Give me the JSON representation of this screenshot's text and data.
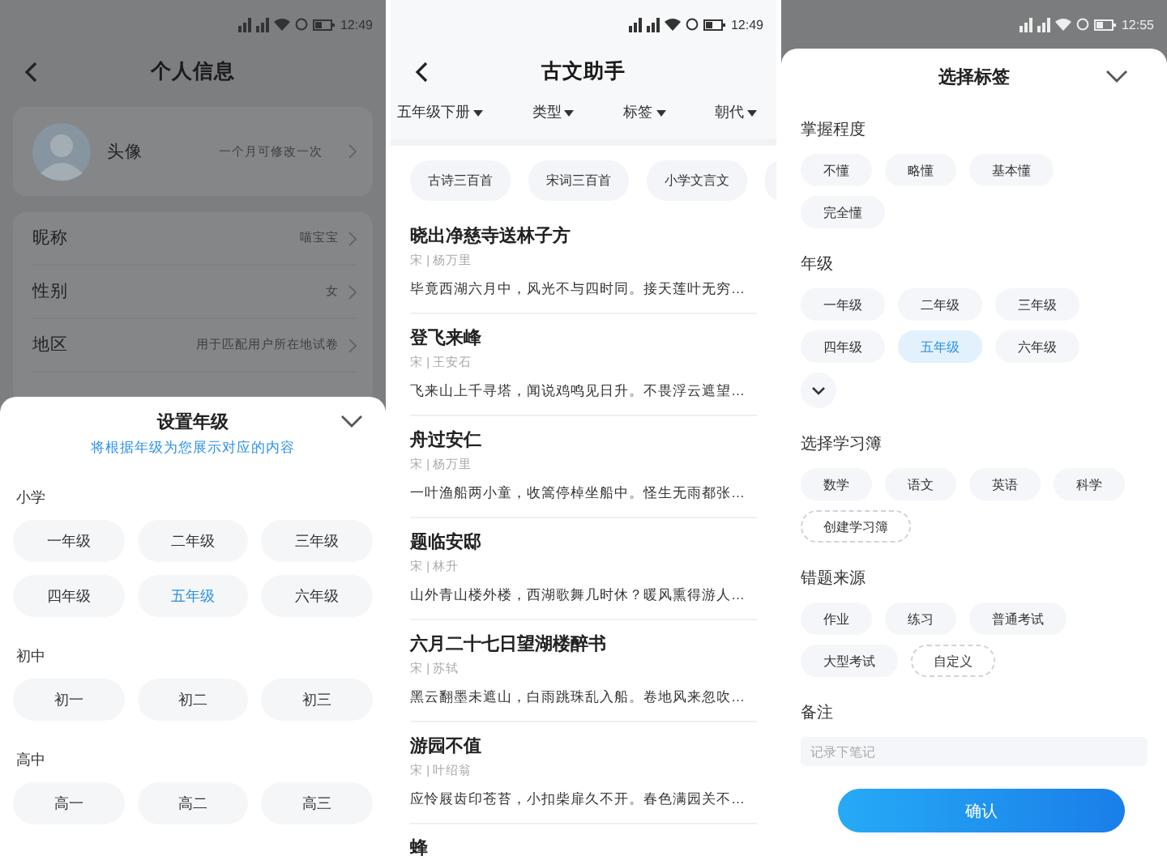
{
  "profile_screen": {
    "status_bar": {
      "time": "12:49"
    },
    "title": "个人信息",
    "avatar_row": {
      "label": "头像",
      "hint": "一个月可修改一次"
    },
    "rows": [
      {
        "label": "昵称",
        "value": "喵宝宝"
      },
      {
        "label": "性别",
        "value": "女"
      },
      {
        "label": "地区",
        "value": "用于匹配用户所在地试卷"
      }
    ],
    "grade_sheet": {
      "title": "设置年级",
      "subtitle": "将根据年级为您展示对应的内容",
      "sections": [
        {
          "heading": "小学",
          "options": [
            {
              "label": "一年级",
              "selected": false
            },
            {
              "label": "二年级",
              "selected": false
            },
            {
              "label": "三年级",
              "selected": false
            },
            {
              "label": "四年级",
              "selected": false
            },
            {
              "label": "五年级",
              "selected": true
            },
            {
              "label": "六年级",
              "selected": false
            }
          ]
        },
        {
          "heading": "初中",
          "options": [
            {
              "label": "初一",
              "selected": false
            },
            {
              "label": "初二",
              "selected": false
            },
            {
              "label": "初三",
              "selected": false
            }
          ]
        },
        {
          "heading": "高中",
          "options": [
            {
              "label": "高一",
              "selected": false
            },
            {
              "label": "高二",
              "selected": false
            },
            {
              "label": "高三",
              "selected": false
            }
          ]
        }
      ]
    }
  },
  "poem_screen": {
    "status_bar": {
      "time": "12:49"
    },
    "title": "古文助手",
    "filters": [
      {
        "label": "五年级下册"
      },
      {
        "label": "类型"
      },
      {
        "label": "标签"
      },
      {
        "label": "朝代"
      }
    ],
    "collections": [
      "古诗三百首",
      "宋词三百首",
      "小学文言文"
    ],
    "poems": [
      {
        "title": "晓出净慈寺送林子方",
        "meta": "宋 | 杨万里",
        "excerpt": "毕竟西湖六月中，风光不与四时同。接天莲叶无穷…"
      },
      {
        "title": "登飞来峰",
        "meta": "宋 | 王安石",
        "excerpt": "飞来山上千寻塔，闻说鸡鸣见日升。不畏浮云遮望…"
      },
      {
        "title": "舟过安仁",
        "meta": "宋 | 杨万里",
        "excerpt": "一叶渔船两小童，收篙停棹坐船中。怪生无雨都张…"
      },
      {
        "title": "题临安邸",
        "meta": "宋 | 林升",
        "excerpt": "山外青山楼外楼，西湖歌舞几时休？暖风熏得游人…"
      },
      {
        "title": "六月二十七日望湖楼醉书",
        "meta": "宋 | 苏轼",
        "excerpt": "黑云翻墨未遮山，白雨跳珠乱入船。卷地风来忽吹…"
      },
      {
        "title": "游园不值",
        "meta": "宋 | 叶绍翁",
        "excerpt": "应怜屐齿印苍苔，小扣柴扉久不开。春色满园关不…"
      },
      {
        "title": "蜂"
      }
    ]
  },
  "tag_screen": {
    "status_bar": {
      "time": "12:55"
    },
    "title": "选择标签",
    "sections": [
      {
        "heading": "掌握程度",
        "options": [
          {
            "label": "不懂",
            "kind": "tag",
            "selected": false
          },
          {
            "label": "略懂",
            "kind": "tag",
            "selected": false
          },
          {
            "label": "基本懂",
            "kind": "tag",
            "selected": false
          },
          {
            "label": "完全懂",
            "kind": "tag",
            "selected": false
          }
        ]
      },
      {
        "heading": "年级",
        "expandable": true,
        "options": [
          {
            "label": "一年级",
            "kind": "tag",
            "selected": false
          },
          {
            "label": "二年级",
            "kind": "tag",
            "selected": false
          },
          {
            "label": "三年级",
            "kind": "tag",
            "selected": false
          },
          {
            "label": "四年级",
            "kind": "tag",
            "selected": false
          },
          {
            "label": "五年级",
            "kind": "tag",
            "selected": true
          },
          {
            "label": "六年级",
            "kind": "tag",
            "selected": false
          }
        ]
      },
      {
        "heading": "选择学习簿",
        "options": [
          {
            "label": "数学",
            "kind": "tag",
            "selected": false
          },
          {
            "label": "语文",
            "kind": "tag",
            "selected": false
          },
          {
            "label": "英语",
            "kind": "tag",
            "selected": false
          },
          {
            "label": "科学",
            "kind": "tag",
            "selected": false
          },
          {
            "label": "创建学习簿",
            "kind": "add",
            "selected": false
          }
        ]
      },
      {
        "heading": "错题来源",
        "options": [
          {
            "label": "作业",
            "kind": "tag",
            "selected": false
          },
          {
            "label": "练习",
            "kind": "tag",
            "selected": false
          },
          {
            "label": "普通考试",
            "kind": "tag",
            "selected": false
          },
          {
            "label": "大型考试",
            "kind": "tag",
            "selected": false
          },
          {
            "label": "自定义",
            "kind": "add",
            "selected": false
          }
        ]
      }
    ],
    "note": {
      "heading": "备注",
      "placeholder": "记录下笔记"
    },
    "confirm": "确认"
  }
}
